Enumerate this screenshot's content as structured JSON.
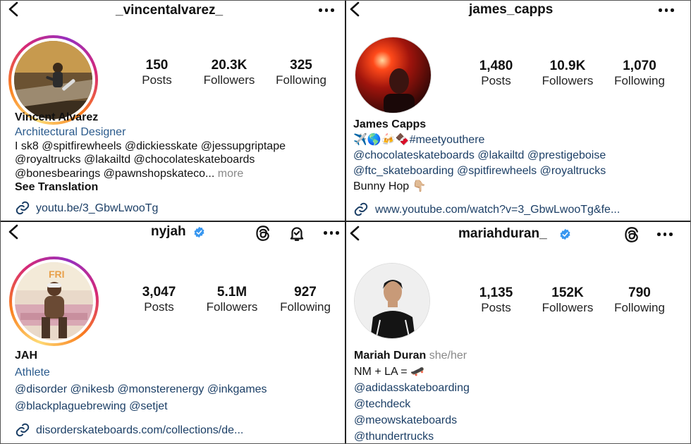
{
  "panels": {
    "vincent": {
      "username": "_vincentalvarez_",
      "stats": [
        {
          "value": "150",
          "label": "Posts"
        },
        {
          "value": "20.3K",
          "label": "Followers"
        },
        {
          "value": "325",
          "label": "Following"
        }
      ],
      "name": "Vincent Alvarez",
      "category": "Architectural Designer",
      "bio_line1": "I sk8 @spitfirewheels @dickiesskate @jessupgriptape",
      "bio_line2": "@royaltrucks @lakailtd  @chocolateskateboards",
      "bio_line3": "@bonesbearings @pawnshopskateco...",
      "more": "more",
      "translation": "See Translation",
      "link": "youtu.be/3_GbwLwooTg"
    },
    "james": {
      "username": "james_capps",
      "stats": [
        {
          "value": "1,480",
          "label": "Posts"
        },
        {
          "value": "10.9K",
          "label": "Followers"
        },
        {
          "value": "1,070",
          "label": "Following"
        }
      ],
      "name": "James Capps",
      "bio_emoji": "✈️🌎🍻🍫",
      "bio_hashtag": "#meetyouthere",
      "bio_line2": "@chocolateskateboards @lakailtd @prestigeboise",
      "bio_line3": "@ftc_skateboarding @spitfirewheels @royaltrucks",
      "bio_line4": "Bunny Hop 👇🏼",
      "link": "www.youtube.com/watch?v=3_GbwLwooTg&fe..."
    },
    "nyjah": {
      "username": "nyjah",
      "stats": [
        {
          "value": "3,047",
          "label": "Posts"
        },
        {
          "value": "5.1M",
          "label": "Followers"
        },
        {
          "value": "927",
          "label": "Following"
        }
      ],
      "name": "JAH",
      "category": "Athlete",
      "bio_line1": "@disorder @nikesb @monsterenergy @inkgames",
      "bio_line2": "@blackplaguebrewing @setjet",
      "link": "disorderskateboards.com/collections/de..."
    },
    "mariah": {
      "username": "mariahduran_",
      "stats": [
        {
          "value": "1,135",
          "label": "Posts"
        },
        {
          "value": "152K",
          "label": "Followers"
        },
        {
          "value": "790",
          "label": "Following"
        }
      ],
      "name": "Mariah Duran",
      "pronouns": "she/her",
      "bio_line1": "NM + LA = 🛹",
      "bio_line2": "@adidasskateboarding",
      "bio_line3": "@techdeck",
      "bio_line4": "@meowskateboards",
      "bio_line5": "@thundertrucks"
    }
  },
  "colors": {
    "link": "#1c3f66",
    "category": "#2a5a8c",
    "verified": "#3897f0",
    "muted": "#888888"
  },
  "icons": [
    "back-chevron-icon",
    "more-dots-icon",
    "verified-badge-icon",
    "threads-icon",
    "notification-bell-icon",
    "link-icon"
  ]
}
